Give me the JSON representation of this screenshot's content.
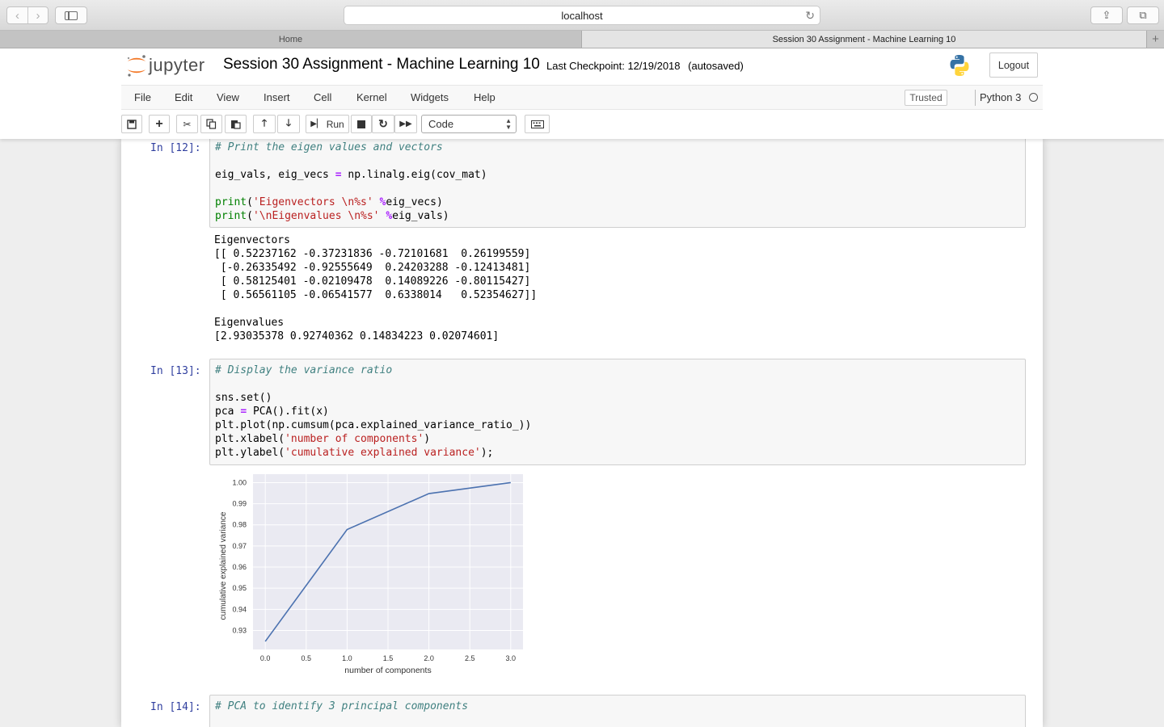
{
  "browser": {
    "address": "localhost",
    "tabs": [
      "Home",
      "Session 30 Assignment - Machine Learning 10"
    ],
    "add_tab": "+"
  },
  "jupyter": {
    "logo_text": "jupyter",
    "notebook_title": "Session 30 Assignment - Machine Learning 10",
    "checkpoint": "Last Checkpoint: 12/19/2018",
    "autosaved": "(autosaved)",
    "logout": "Logout",
    "menu": [
      "File",
      "Edit",
      "View",
      "Insert",
      "Cell",
      "Kernel",
      "Widgets",
      "Help"
    ],
    "trusted": "Trusted",
    "kernel": "Python 3",
    "run_label": "Run",
    "cell_type": "Code"
  },
  "cells": {
    "c12": {
      "prompt": "In [12]:",
      "comment": "# Print the eigen values and vectors",
      "line2": "eig_vals, eig_vecs ",
      "line2_op": "=",
      "line2_rest": " np.linalg.eig(cov_mat)",
      "print_kw": "print",
      "str1": "'Eigenvectors \\n%s'",
      "op_pct": "%",
      "rest1": "eig_vecs)",
      "str2": "'\\nEigenvalues \\n%s'",
      "rest2": "eig_vals)",
      "output": [
        "Eigenvectors",
        "[[ 0.52237162 -0.37231836 -0.72101681  0.26199559]",
        " [-0.26335492 -0.92555649  0.24203288 -0.12413481]",
        " [ 0.58125401 -0.02109478  0.14089226 -0.80115427]",
        " [ 0.56561105 -0.06541577  0.6338014   0.52354627]]",
        "",
        "Eigenvalues",
        "[2.93035378 0.92740362 0.14834223 0.02074601]"
      ]
    },
    "c13": {
      "prompt": "In [13]:",
      "comment": "# Display the variance ratio",
      "l1": "sns.set()",
      "l2a": "pca ",
      "l2op": "=",
      "l2b": " PCA().fit(x)",
      "l3": "plt.plot(np.cumsum(pca.explained_variance_ratio_))",
      "l4a": "plt.xlabel(",
      "l4s": "'number of components'",
      "l4b": ")",
      "l5a": "plt.ylabel(",
      "l5s": "'cumulative explained variance'",
      "l5b": ");"
    },
    "c14": {
      "prompt": "In [14]:",
      "comment": "# PCA to identify 3 principal components"
    }
  },
  "chart_data": {
    "type": "line",
    "x": [
      0,
      1,
      2,
      3
    ],
    "values": [
      0.9248,
      0.9778,
      0.9948,
      1.0
    ],
    "xlabel": "number of components",
    "ylabel": "cumulative explained variance",
    "xlim": [
      -0.15,
      3.15
    ],
    "ylim": [
      0.921,
      1.004
    ],
    "xticks": [
      "0.0",
      "0.5",
      "1.0",
      "1.5",
      "2.0",
      "2.5",
      "3.0"
    ],
    "yticks": [
      "0.93",
      "0.94",
      "0.95",
      "0.96",
      "0.97",
      "0.98",
      "0.99",
      "1.00"
    ],
    "grid": true,
    "line_color": "#4c72b0",
    "background": "#eaeaf2"
  }
}
